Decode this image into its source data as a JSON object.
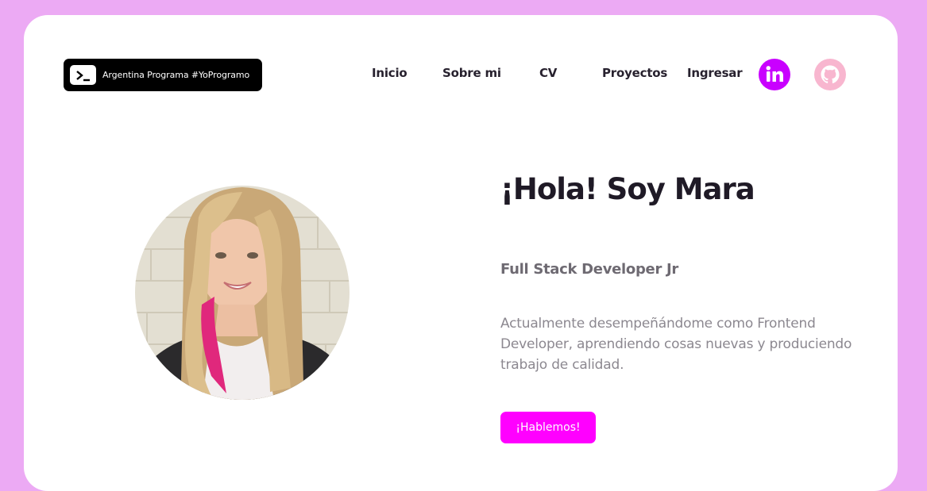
{
  "colors": {
    "page_background": "#ecaaf4",
    "card_background": "#ffffff",
    "logo_background": "#000000",
    "nav_text": "#27212e",
    "linkedin_bg": "#c900ff",
    "github_bg": "#f8b6cf",
    "title_text": "#1f1a26",
    "role_text": "#6e6a72",
    "description_text": "#8c8890",
    "cta_background": "#ff00ff",
    "cta_text": "#ffffff"
  },
  "header": {
    "logo": {
      "icon": "terminal-icon",
      "text": "Argentina Programa  #YoProgramo"
    },
    "nav": [
      {
        "label": "Inicio"
      },
      {
        "label": "Sobre mi"
      },
      {
        "label": "CV"
      },
      {
        "label": "Proyectos"
      },
      {
        "label": "Ingresar"
      }
    ],
    "social": [
      {
        "icon": "linkedin-icon"
      },
      {
        "icon": "github-icon"
      }
    ]
  },
  "hero": {
    "avatar": "profile-photo",
    "title": "¡Hola! Soy Mara",
    "role": "Full Stack Developer Jr",
    "description": "Actualmente desempeñándome como Frontend Developer, aprendiendo cosas nuevas y produciendo trabajo de calidad.",
    "cta_label": "¡Hablemos!"
  }
}
